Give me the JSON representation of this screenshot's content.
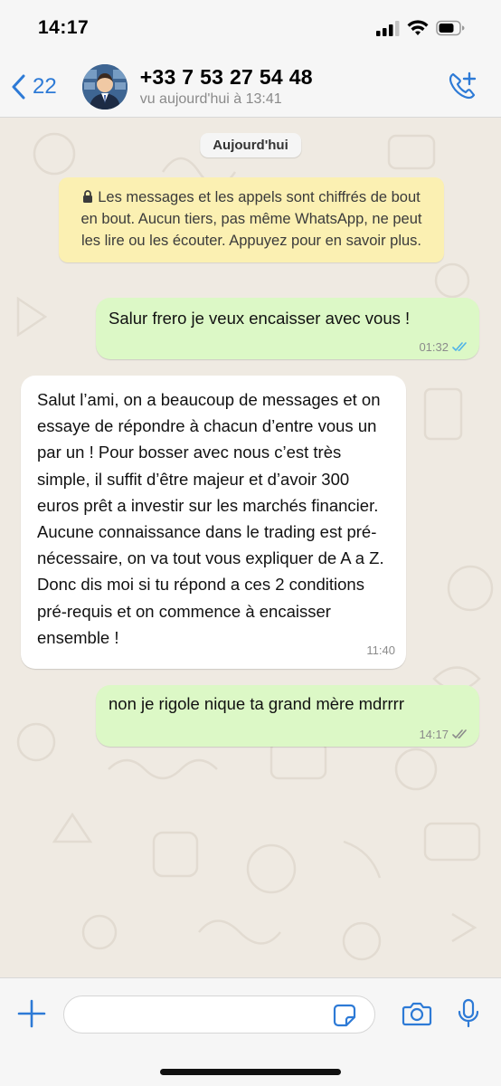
{
  "statusbar": {
    "time": "14:17"
  },
  "header": {
    "back_count": "22",
    "contact_name": "+33 7 53 27 54 48",
    "last_seen": "vu aujourd'hui à 13:41"
  },
  "chat": {
    "date_chip": "Aujourd'hui",
    "encryption_notice": "Les messages et les appels sont chiffrés de bout en bout. Aucun tiers, pas même WhatsApp, ne peut les lire ou les écouter. Appuyez pour en savoir plus.",
    "messages": [
      {
        "direction": "outgoing",
        "text": "Salur frero je veux encaisser avec vous !",
        "time": "01:32",
        "status": "read"
      },
      {
        "direction": "incoming",
        "text": "Salut l’ami, on a beaucoup de messages et on essaye de répondre à chacun d’entre vous un par un ! Pour bosser avec nous c’est très simple, il suffit d’être majeur et d’avoir 300 euros prêt a investir sur les marchés financier. Aucune connaissance dans le trading est pré-nécessaire, on va tout vous expliquer de A a Z. Donc dis moi si tu répond a ces 2 conditions pré-requis et on commence à encaisser ensemble !",
        "time": "11:40"
      },
      {
        "direction": "outgoing",
        "text": "non je rigole nique ta grand mère mdrrrr",
        "time": "14:17",
        "status": "delivered"
      }
    ]
  },
  "input": {
    "value": "",
    "placeholder": ""
  },
  "colors": {
    "accent": "#2d7ad6",
    "outgoing_bubble": "#dcf8c6",
    "incoming_bubble": "#ffffff",
    "notice_bg": "#fbf0b2",
    "read_ticks": "#4fb3e8",
    "delivered_ticks": "#8b8b8b"
  },
  "icons": {
    "back": "chevron-left-icon",
    "call_add": "phone-plus-icon",
    "lock": "lock-icon",
    "plus": "plus-icon",
    "sticker": "sticker-icon",
    "camera": "camera-icon",
    "mic": "microphone-icon"
  }
}
